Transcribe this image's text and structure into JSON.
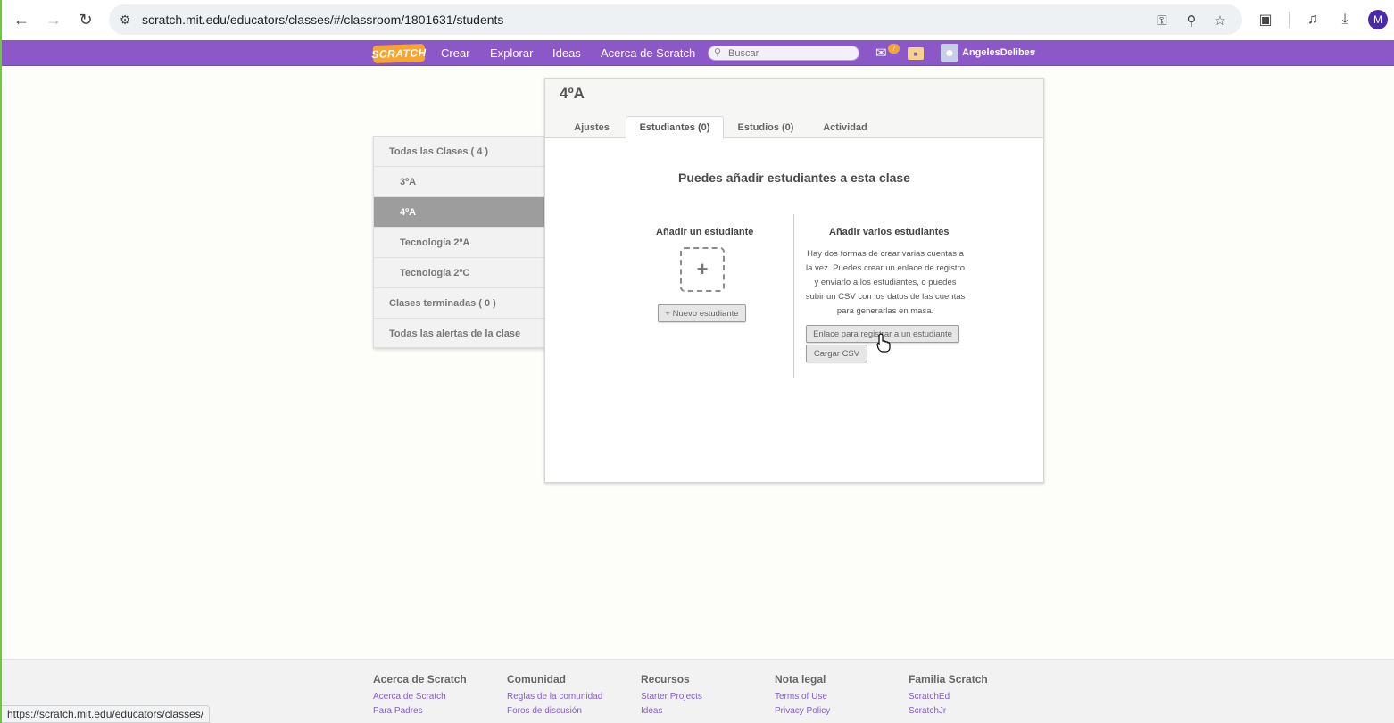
{
  "browser": {
    "url": "scratch.mit.edu/educators/classes/#/classroom/1801631/students",
    "status_url": "https://scratch.mit.edu/educators/classes/",
    "profile_initial": "M"
  },
  "nav": {
    "logo": "SCRATCH",
    "links": [
      "Crear",
      "Explorar",
      "Ideas",
      "Acerca de Scratch"
    ],
    "search_placeholder": "Buscar",
    "messages_count": "7",
    "username": "AngelesDelibes"
  },
  "sidebar": {
    "items": [
      {
        "label": "Todas las Clases ( 4 )",
        "level": "top",
        "active": false
      },
      {
        "label": "3ºA",
        "level": "sub",
        "active": false
      },
      {
        "label": "4ºA",
        "level": "sub",
        "active": true
      },
      {
        "label": "Tecnología 2ºA",
        "level": "sub",
        "active": false
      },
      {
        "label": "Tecnología 2ºC",
        "level": "sub",
        "active": false
      },
      {
        "label": "Clases terminadas ( 0 )",
        "level": "top",
        "active": false
      },
      {
        "label": "Todas las alertas de la clase",
        "level": "top",
        "active": false
      }
    ]
  },
  "panel": {
    "class_title": "4ºA",
    "tabs": [
      {
        "label": "Ajustes",
        "active": false
      },
      {
        "label": "Estudiantes (0)",
        "active": true
      },
      {
        "label": "Estudios (0)",
        "active": false
      },
      {
        "label": "Actividad",
        "active": false
      }
    ],
    "section_title": "Puedes añadir estudiantes a esta clase",
    "single": {
      "title": "Añadir un estudiante",
      "plus": "+",
      "button": "+ Nuevo estudiante"
    },
    "multiple": {
      "title": "Añadir varios estudiantes",
      "description": "Hay dos formas de crear varias cuentas a la vez. Puedes crear un enlace de registro y enviarlo a los estudiantes, o puedes subir un CSV con los datos de las cuentas para generarlas en masa.",
      "link_button": "Enlace para registrar a un estudiante",
      "csv_button": "Cargar CSV"
    }
  },
  "footer": {
    "columns": [
      {
        "title": "Acerca de Scratch",
        "links": [
          "Acerca de Scratch",
          "Para Padres"
        ]
      },
      {
        "title": "Comunidad",
        "links": [
          "Reglas de la comunidad",
          "Foros de discusión"
        ]
      },
      {
        "title": "Recursos",
        "links": [
          "Starter Projects",
          "Ideas"
        ]
      },
      {
        "title": "Nota legal",
        "links": [
          "Terms of Use",
          "Privacy Policy"
        ]
      },
      {
        "title": "Familia Scratch",
        "links": [
          "ScratchEd",
          "ScratchJr"
        ]
      }
    ]
  }
}
